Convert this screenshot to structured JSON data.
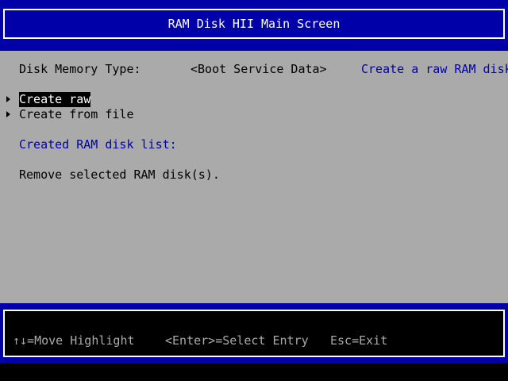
{
  "header": {
    "title": "RAM Disk HII Main Screen"
  },
  "form": {
    "disk_memory_type_label": "Disk Memory Type:",
    "disk_memory_type_value": "<Boot Service Data>",
    "help_text": "Create a raw RAM disk.",
    "menu_items": [
      {
        "label": "Create raw",
        "selected": true
      },
      {
        "label": "Create from file",
        "selected": false
      }
    ],
    "created_list_label": "Created RAM disk list:",
    "remove_label": "Remove selected RAM disk(s)."
  },
  "footer": {
    "move_hint": "↑↓=Move Highlight",
    "enter_hint": "<Enter>=Select Entry",
    "esc_hint": "Esc=Exit"
  },
  "colors": {
    "background": "#000000",
    "panel": "#aaaaaa",
    "bar": "#0000a8",
    "accent_text": "#0000a8",
    "highlight_bg": "#000000",
    "highlight_text": "#ffffff"
  },
  "icons": {
    "menu_pointer": "triangle-right-icon"
  }
}
